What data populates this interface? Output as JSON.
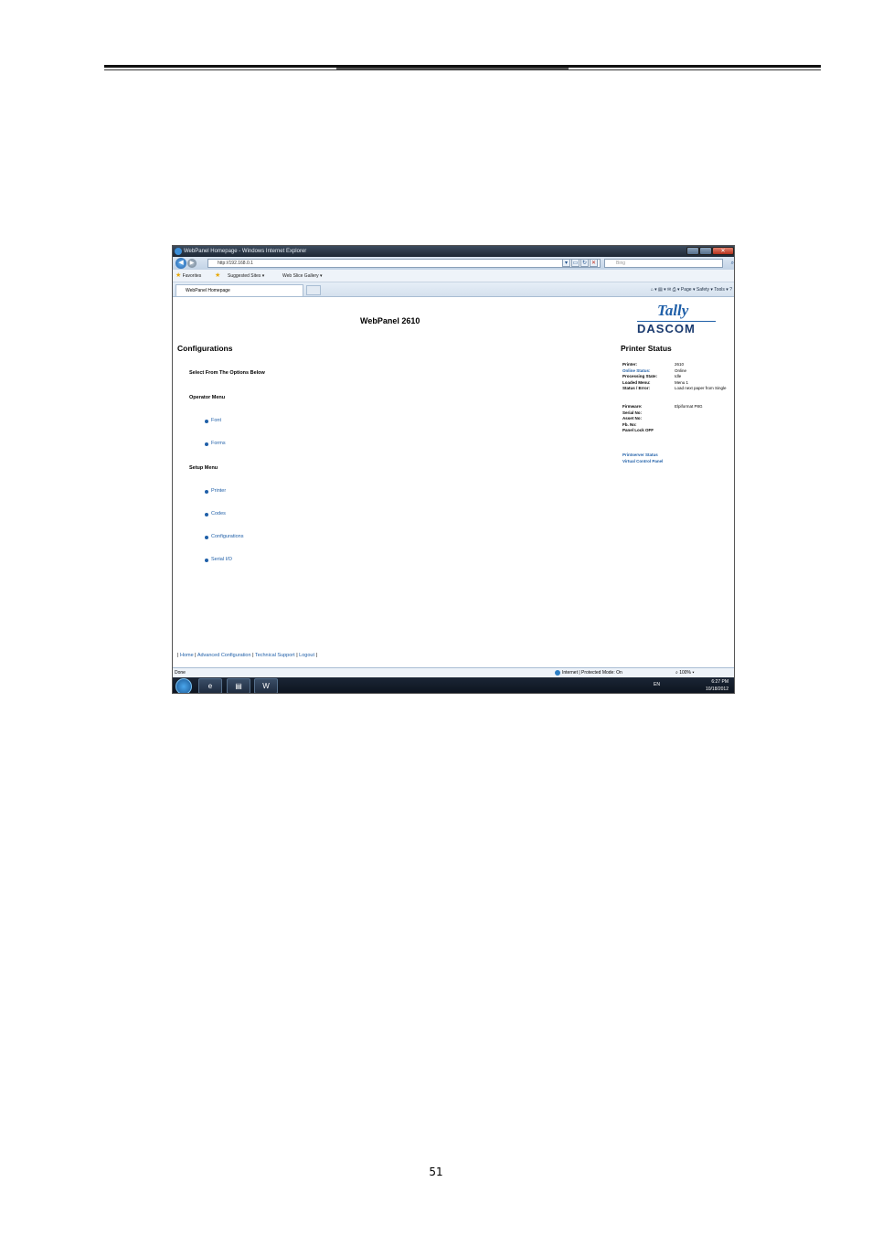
{
  "document": {
    "page_number": "51"
  },
  "browser": {
    "window_title": "WebPanel Homepage - Windows Internet Explorer",
    "address": "http://192.168.0.1",
    "search_placeholder": "Bing",
    "favorites": {
      "label": "Favorites",
      "suggested": "Suggested Sites ▾",
      "gallery": "Web Slice Gallery ▾"
    },
    "tab_label": "WebPanel Homepage",
    "command_bar": "Page ▾   Safety ▾   Tools ▾",
    "status_left": "Done",
    "status_zone": "Internet | Protected Mode: On",
    "zoom": "100%"
  },
  "webpanel": {
    "title": "WebPanel 2610",
    "logo_top": "Tally",
    "logo_bottom": "DASCOM",
    "configurations_heading": "Configurations",
    "select_label": "Select From The Options Below",
    "operator_menu_label": "Operator Menu",
    "operator_items": [
      "Font",
      "Forms"
    ],
    "setup_menu_label": "Setup Menu",
    "setup_items": [
      "Printer",
      "Codes",
      "Configurations",
      "Serial I/O"
    ],
    "status_heading": "Printer Status",
    "status": {
      "printer_k": "Printer:",
      "printer_v": "2610",
      "online_k": "Online Status:",
      "online_v": "Online",
      "processing_k": "Processing State:",
      "processing_v": "Idle",
      "menu_k": "Loaded Menu:",
      "menu_v": "Menu 1",
      "error_k": "Status / Error:",
      "error_v": "Load next paper from Single",
      "firmware_k": "Firmware:",
      "firmware_v": "Elpiformat P8G",
      "serial_k": "Serial No:",
      "asset_k": "Asset No:",
      "fb_k": "Fb. No:",
      "lock_k": "Panel Lock OFF"
    },
    "printserver_link": "Printserver Status",
    "vcp_link": "Virtual Control Panel",
    "footer": {
      "home": "Home",
      "advanced": "Advanced Configuration",
      "support": "Technical Support",
      "logout": "Logout"
    }
  },
  "taskbar": {
    "lang": "EN",
    "time": "6:27 PM",
    "date": "10/18/2012",
    "word_icon": "W"
  }
}
